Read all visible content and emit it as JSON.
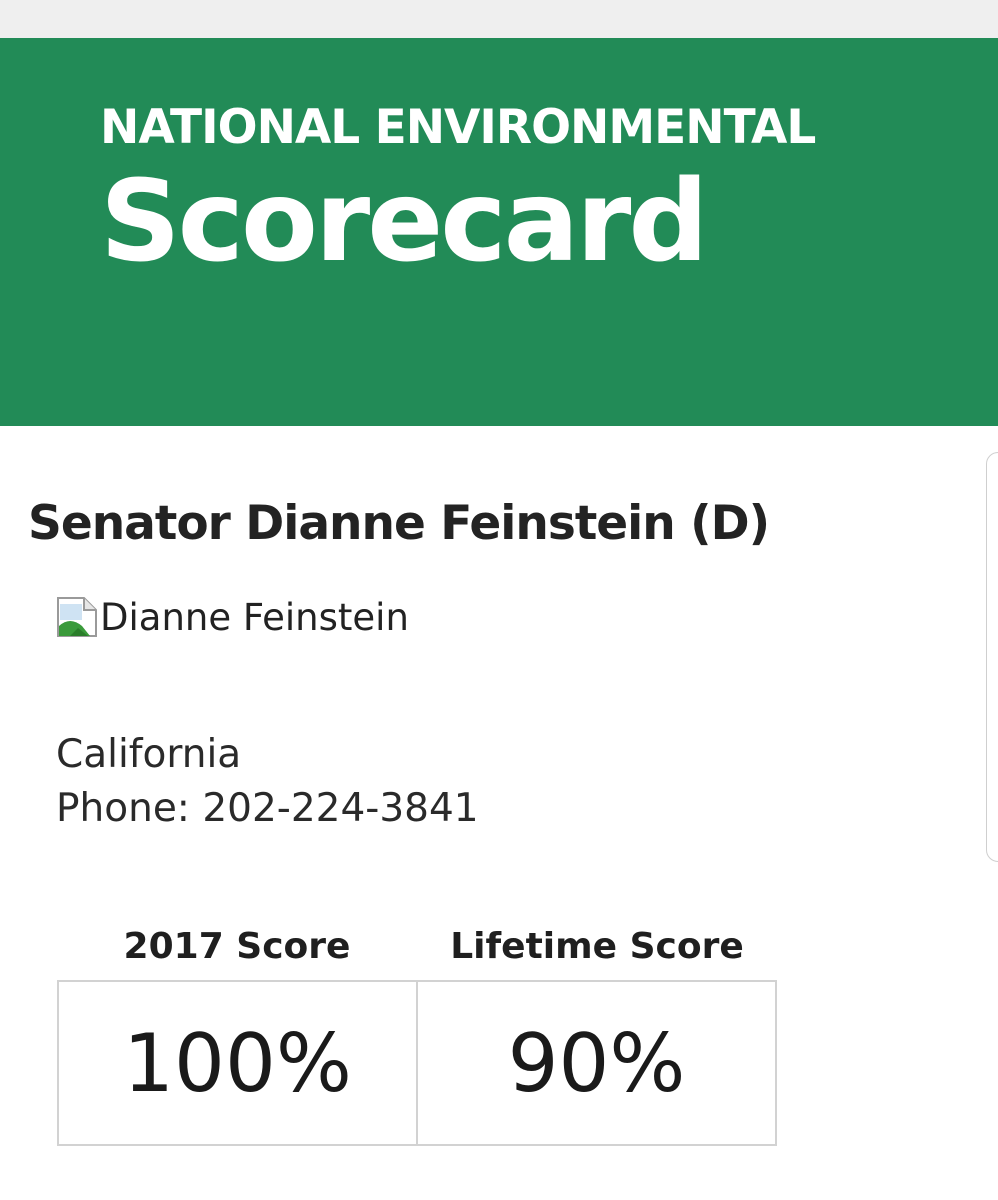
{
  "header": {
    "subtitle": "NATIONAL ENVIRONMENTAL",
    "title": "Scorecard",
    "background_color": "#228b57"
  },
  "profile": {
    "name": "Senator Dianne Feinstein (D)",
    "photo_alt": "Dianne Feinstein",
    "photo_icon": "broken-image-icon",
    "state": "California",
    "phone": "Phone: 202-224-3841"
  },
  "scores": [
    {
      "label": "2017 Score",
      "value": "100%"
    },
    {
      "label": "Lifetime Score",
      "value": "90%"
    }
  ]
}
